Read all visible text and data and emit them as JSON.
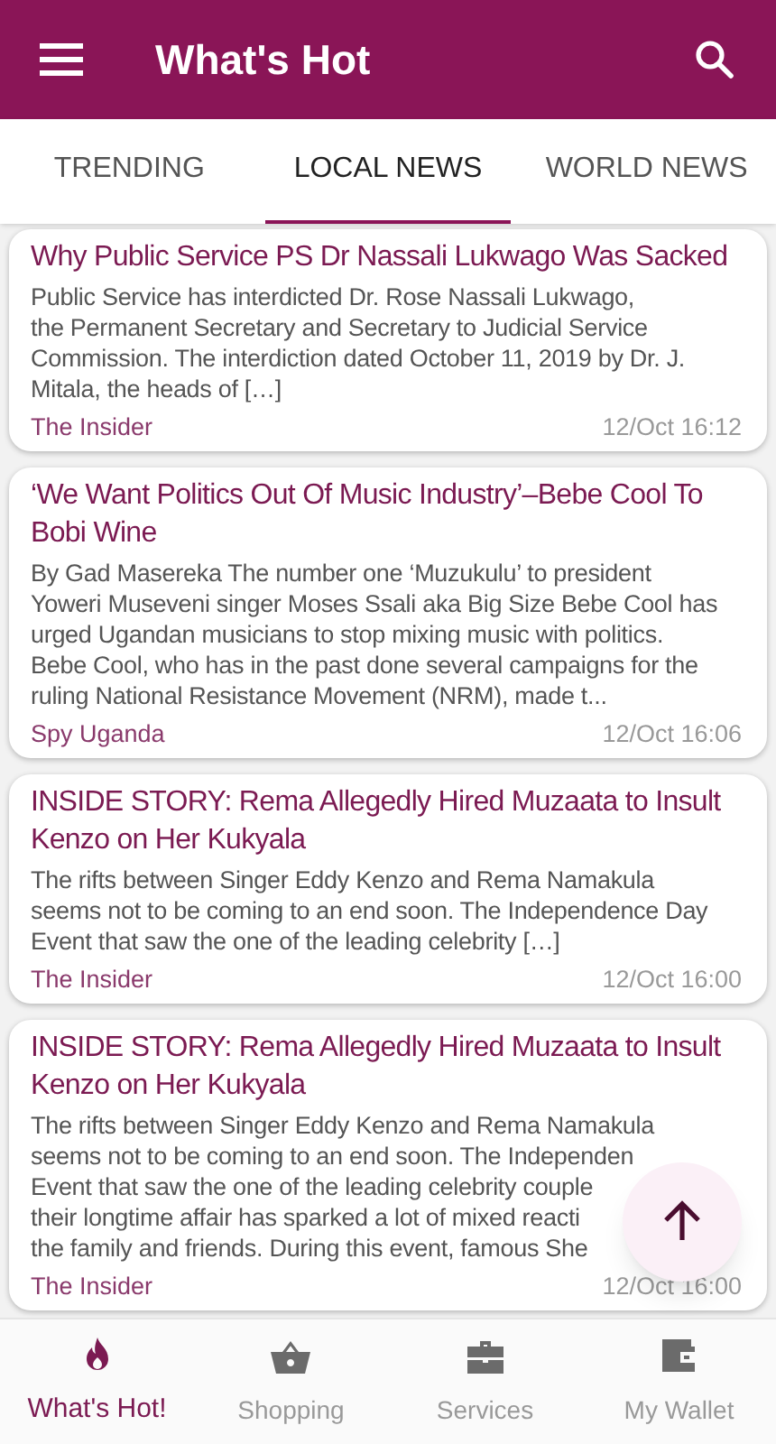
{
  "app_bar": {
    "title": "What's Hot"
  },
  "tabs": [
    {
      "label": "TRENDING",
      "selected": false
    },
    {
      "label": "LOCAL NEWS",
      "selected": true
    },
    {
      "label": "WORLD NEWS",
      "selected": false
    }
  ],
  "articles": [
    {
      "title": "Why Public Service PS Dr Nassali Lukwago Was Sacked",
      "excerpt_lines": [
        "Public Service has interdicted Dr. Rose Nassali Lukwago,",
        "the Permanent Secretary and Secretary to Judicial Service",
        "Commission. The interdiction dated October 11, 2019 by Dr. J.",
        "Mitala, the heads of […]"
      ],
      "source": "The Insider",
      "time": "12/Oct 16:12"
    },
    {
      "title": "‘We Want Politics Out Of Music Industry’–Bebe Cool To Bobi Wine",
      "excerpt_lines": [
        "By Gad Masereka The number one ‘Muzukulu’ to president",
        "Yoweri Museveni singer Moses Ssali aka Big Size Bebe Cool has",
        "urged Ugandan musicians to stop mixing music with politics.",
        "Bebe Cool, who has in the past done several campaigns for the",
        "ruling National Resistance Movement (NRM), made t..."
      ],
      "source": "Spy Uganda",
      "time": "12/Oct 16:06"
    },
    {
      "title": "INSIDE STORY: Rema Allegedly Hired Muzaata to Insult Kenzo on Her Kukyala",
      "excerpt_lines": [
        "The rifts between Singer Eddy Kenzo and Rema Namakula",
        "seems not to be coming to an end soon. The Independence Day",
        "Event that saw the one of the leading celebrity […]"
      ],
      "source": "The Insider",
      "time": "12/Oct 16:00"
    },
    {
      "title": "INSIDE STORY: Rema Allegedly Hired Muzaata to Insult Kenzo on Her Kukyala",
      "excerpt_lines": [
        "The rifts between Singer Eddy Kenzo and Rema Namakula",
        "seems not to be coming to an end soon. The Independen",
        "Event that saw the one of the leading celebrity couple",
        "their longtime affair has sparked a lot of mixed reacti",
        "the family and friends. During this event, famous She"
      ],
      "source": "The Insider",
      "time": "12/Oct 16:00"
    }
  ],
  "bottom_nav": [
    {
      "label": "What's Hot!",
      "kind": "flame",
      "selected": true
    },
    {
      "label": "Shopping",
      "kind": "basket",
      "selected": false
    },
    {
      "label": "Services",
      "kind": "briefcase",
      "selected": false
    },
    {
      "label": "My Wallet",
      "kind": "wallet",
      "selected": false
    }
  ]
}
